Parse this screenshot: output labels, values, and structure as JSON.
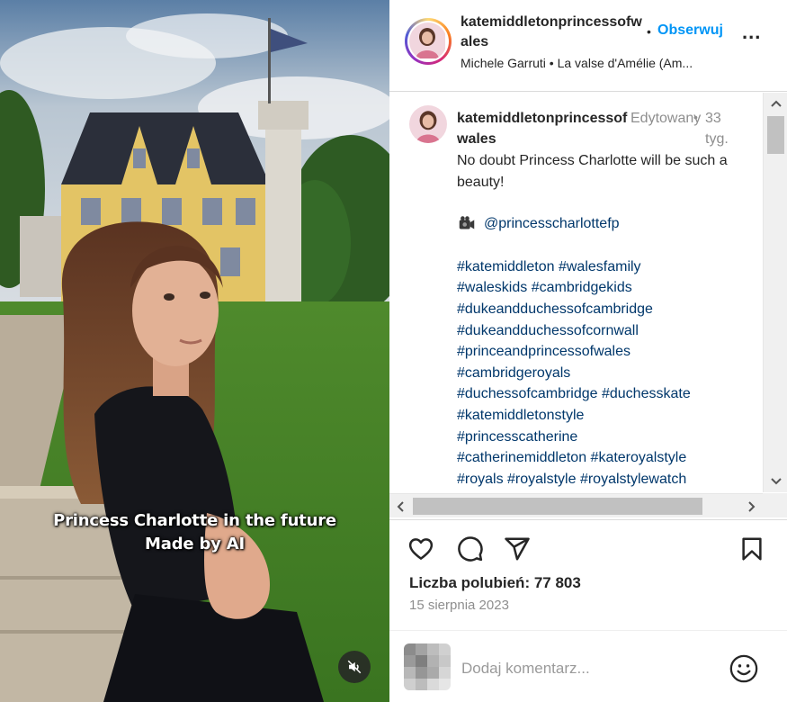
{
  "post": {
    "username": "katemiddletonprincessofwales",
    "follow_label": "Obserwuj",
    "header_dot": "•",
    "more_label": "...",
    "audio_text": "Michele Garruti • La valse d'Amélie (Am...",
    "caption_overlay": {
      "line1": "Princess Charlotte in the future",
      "line2": "Made by AI"
    }
  },
  "comment": {
    "username": "katemiddletonprincessofwales",
    "edited_label": "Edytowany",
    "dot": "•",
    "age": "33 tyg.",
    "text": "No doubt Princess Charlotte will be such a beauty!",
    "mention": "@princesscharlottefp",
    "hashtags": [
      "#katemiddleton #walesfamily",
      "#waleskids #cambridgekids",
      "#dukeandduchessofcambridge",
      "#dukeandduchessofcornwall",
      "#princeandprincessofwales",
      "#cambridgeroyals",
      "#duchessofcambridge #duchesskate",
      "#katemiddletonstyle",
      "#princesscatherine",
      "#catherinemiddleton #kateroyalstyle",
      "#royals #royalstyle #royalstylewatch"
    ]
  },
  "actions": {
    "icons": [
      "heart-icon",
      "comment-icon",
      "share-icon",
      "bookmark-icon"
    ]
  },
  "stats": {
    "likes_text": "Liczba polubień: 77 803",
    "date_text": "15 sierpnia 2023"
  },
  "composer": {
    "placeholder": "Dodaj komentarz..."
  },
  "colors": {
    "accent": "#0095f6",
    "link": "#00376b",
    "muted": "#8e8e8e",
    "text": "#262626"
  }
}
